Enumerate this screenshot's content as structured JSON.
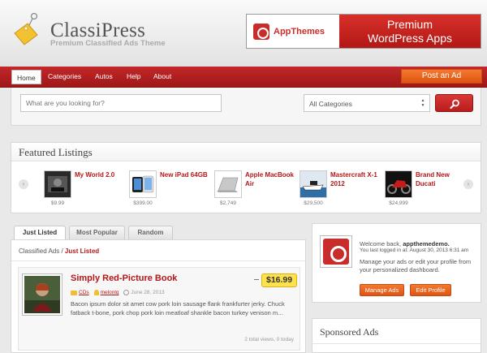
{
  "header": {
    "title": "ClassiPress",
    "tagline": "Premium Classified Ads Theme",
    "banner": {
      "brand": "AppThemes",
      "line1": "Premium",
      "line2": "WordPress Apps"
    }
  },
  "nav": {
    "items": [
      {
        "label": "Home",
        "active": true
      },
      {
        "label": "Categories",
        "active": false
      },
      {
        "label": "Autos",
        "active": false
      },
      {
        "label": "Help",
        "active": false
      },
      {
        "label": "About",
        "active": false
      }
    ],
    "post_ad": "Post an Ad"
  },
  "search": {
    "placeholder": "What are you looking for?",
    "category": "All Categories"
  },
  "featured": {
    "title": "Featured Listings",
    "prev": "‹",
    "next": "›",
    "items": [
      {
        "title": "My World 2.0",
        "price": "$9.99",
        "thumb": "cd-cover"
      },
      {
        "title": "New iPad 64GB",
        "price": "$399.00",
        "thumb": "ipad"
      },
      {
        "title": "Apple MacBook Air",
        "price": "$2,749",
        "thumb": "macbook"
      },
      {
        "title": "Mastercraft X-1 2012",
        "price": "$29,500",
        "thumb": "boat"
      },
      {
        "title": "Brand New Ducati",
        "price": "$24,999",
        "thumb": "motorcycle"
      }
    ]
  },
  "tabs": [
    "Just Listed",
    "Most Popular",
    "Random"
  ],
  "breadcrumb": {
    "root": "Classified Ads",
    "sep": " / ",
    "current": "Just Listed"
  },
  "listing": {
    "title": "Simply Red-Picture Book",
    "price": "$16.99",
    "category": "CDs",
    "author": "melonlq",
    "date": "June 28, 2013",
    "description": "Bacon ipsum dolor sit amet cow pork loin sausage flank frankfurter jerky. Chuck fatback t-bone, pork chop pork loin meatloaf shankle bacon turkey venison m...",
    "stats": "2 total views, 0 today"
  },
  "welcome": {
    "greeting": "Welcome back,",
    "user": "appthemedemo.",
    "last_login": "You last logged in at: August 30, 2013 6:31 am",
    "message": "Manage your ads or edit your profile from your personalized dashboard.",
    "manage_btn": "Manage Ads",
    "profile_btn": "Edit Profile"
  },
  "sponsored": {
    "title": "Sponsored Ads"
  }
}
